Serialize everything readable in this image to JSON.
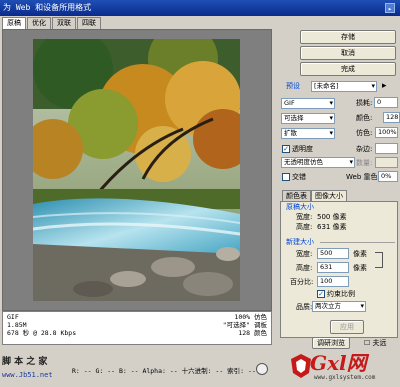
{
  "window": {
    "title": "为 Web 和设备所用格式",
    "menu_icon": "▸"
  },
  "tabs": [
    {
      "label": "原稿",
      "active": true
    },
    {
      "label": "优化",
      "active": false
    },
    {
      "label": "双联",
      "active": false
    },
    {
      "label": "四联",
      "active": false
    }
  ],
  "info": {
    "format": "GIF",
    "size": "1.85M",
    "speed": "678 秒 @ 28.8 Kbps",
    "quality": "100% 仿色",
    "palette_method": "\"可选择\" 调板",
    "colors": "128 颜色"
  },
  "buttons": {
    "save": "存储",
    "cancel": "取消",
    "done": "完成",
    "apply": "应用"
  },
  "preset": {
    "label": "预设",
    "value": "[未命名]",
    "format": "GIF",
    "reduction": "可选择",
    "dither": "扩散",
    "transparency_label": "透明度",
    "transparency_checked": true,
    "matte_dither": "无透明度仿色",
    "interlaced_label": "交错",
    "interlaced_checked": false,
    "lossy_label": "损耗:",
    "lossy_value": "0",
    "colors_label": "颜色:",
    "colors_value": "128",
    "dither_label": "仿色:",
    "dither_value": "100%",
    "matte_label": "杂边:",
    "amount_label": "数量:",
    "web_snap_label": "Web 靠色:",
    "web_snap_value": "0%"
  },
  "panel_tabs": [
    {
      "label": "颜色表",
      "active": false
    },
    {
      "label": "图像大小",
      "active": true
    }
  ],
  "image_size": {
    "original_title": "原稿大小",
    "orig_width_label": "宽度:",
    "orig_width": "500 像素",
    "orig_height_label": "高度:",
    "orig_height": "631 像素",
    "new_title": "新建大小",
    "width_label": "宽度:",
    "width_value": "500",
    "height_label": "高度:",
    "height_value": "631",
    "unit": "像素",
    "percent_label": "百分比:",
    "percent_value": "100",
    "constrain_label": "约束比例",
    "constrain_checked": true,
    "quality_label": "品质:",
    "quality_value": "两次立方"
  },
  "status_bar": {
    "text": "R: --   G: --   B: --   Alpha: --   十六进制: --   索引: --",
    "browser_button": "调研浏览",
    "browser_dropdown": "☐ 夫远"
  },
  "watermark": {
    "left_title": "脚 本 之 家",
    "left_url": "www.Jb51.net",
    "logo_text": "Gxl网",
    "logo_url": "www.gxlsystem.com"
  }
}
